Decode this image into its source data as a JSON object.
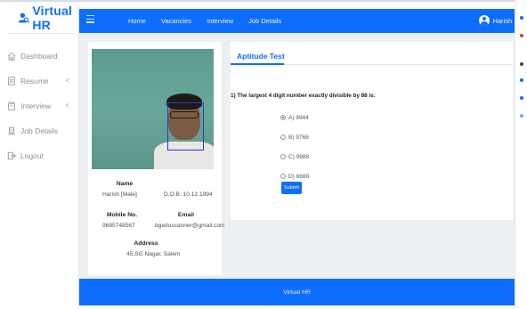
{
  "brand": {
    "name": "Virtual HR",
    "logo_icon": "user-search-icon",
    "color": "#0d6efd"
  },
  "sidebar": {
    "items": [
      {
        "label": "Dashboard",
        "icon": "home-icon",
        "has_chevron": false
      },
      {
        "label": "Resume",
        "icon": "document-icon",
        "has_chevron": true
      },
      {
        "label": "Interview",
        "icon": "clipboard-icon",
        "has_chevron": true
      },
      {
        "label": "Job Details",
        "icon": "building-icon",
        "has_chevron": false
      },
      {
        "label": "Logout",
        "icon": "logout-icon",
        "has_chevron": false
      }
    ],
    "chevron": "<"
  },
  "header": {
    "nav": [
      "Home",
      "Vacancies",
      "Interview",
      "Job Details"
    ],
    "user_name": "Harish",
    "user_chevron": "⌄"
  },
  "profile": {
    "name_label": "Name",
    "name_value": "Harish [Male]",
    "dob_value": "D.O.B: 10.12.1994",
    "mobile_label": "Mobile No.",
    "mobile_value": "9685748567",
    "email_label": "Email",
    "email_value": "bgeduscanner@gmail.com",
    "address_label": "Address",
    "address_value": "45,SG Nagar, Salem"
  },
  "test": {
    "title": "Aptitude Test",
    "question": "1) The largest 4 digit number exactly divisible by 88 is:",
    "options": [
      "A) 9944",
      "B) 9768",
      "C) 9988",
      "D) 8888"
    ],
    "selected_index": 0,
    "submit_label": "Submit"
  },
  "footer": {
    "text": "Virtual HR"
  }
}
